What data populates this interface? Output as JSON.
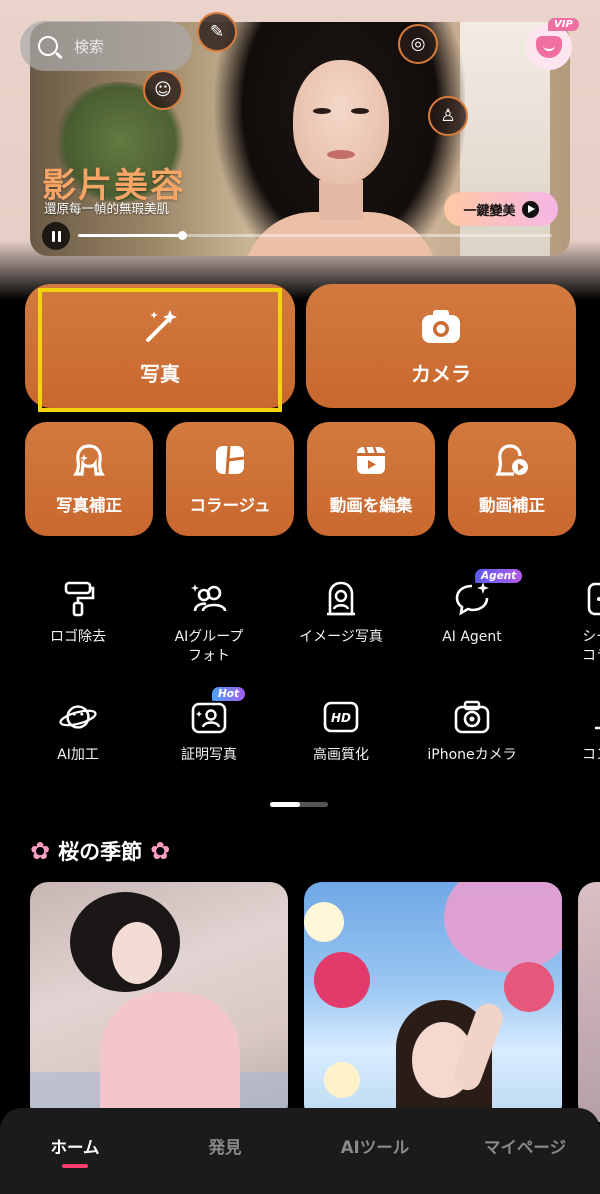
{
  "search": {
    "placeholder": "検索"
  },
  "banner": {
    "title": "影片美容",
    "subtitle": "還原每一幀的無瑕美肌",
    "cta_label": "一鍵變美",
    "vip_tag": "VIP",
    "playback_progress": 0.22
  },
  "main_actions": [
    {
      "label": "写真",
      "icon": "magic-wand-icon"
    },
    {
      "label": "カメラ",
      "icon": "camera-icon"
    }
  ],
  "secondary_actions": [
    {
      "label": "写真補正",
      "icon": "face-retouch-icon"
    },
    {
      "label": "コラージュ",
      "icon": "collage-icon"
    },
    {
      "label": "動画を編集",
      "icon": "video-edit-icon"
    },
    {
      "label": "動画補正",
      "icon": "video-retouch-icon"
    }
  ],
  "tools_row1": [
    {
      "label": "ロゴ除去",
      "icon": "paint-roller-icon"
    },
    {
      "label": "AIグループ\nフォト",
      "icon": "group-photo-icon"
    },
    {
      "label": "イメージ写真",
      "icon": "portrait-frame-icon"
    },
    {
      "label": "AI Agent",
      "icon": "chat-sparkle-icon",
      "badge": "Agent"
    },
    {
      "label": "シーム\nコラー",
      "icon": "seamless-collage-icon"
    }
  ],
  "tools_row2": [
    {
      "label": "AI加工",
      "icon": "planet-icon"
    },
    {
      "label": "証明写真",
      "icon": "id-photo-icon",
      "badge": "Hot"
    },
    {
      "label": "高画質化",
      "icon": "hd-icon"
    },
    {
      "label": "iPhoneカメラ",
      "icon": "iphone-camera-icon"
    },
    {
      "label": "コンテ",
      "icon": "microscope-icon"
    }
  ],
  "section": {
    "title": "桜の季節",
    "icon": "sakura-icon"
  },
  "nav": {
    "items": [
      {
        "label": "ホーム",
        "active": true
      },
      {
        "label": "発見",
        "active": false
      },
      {
        "label": "AIツール",
        "active": false
      },
      {
        "label": "マイページ",
        "active": false
      }
    ]
  },
  "colors": {
    "accent": "#cf7238",
    "highlight": "#f2d30e",
    "active_tab": "#ff3d6e"
  }
}
